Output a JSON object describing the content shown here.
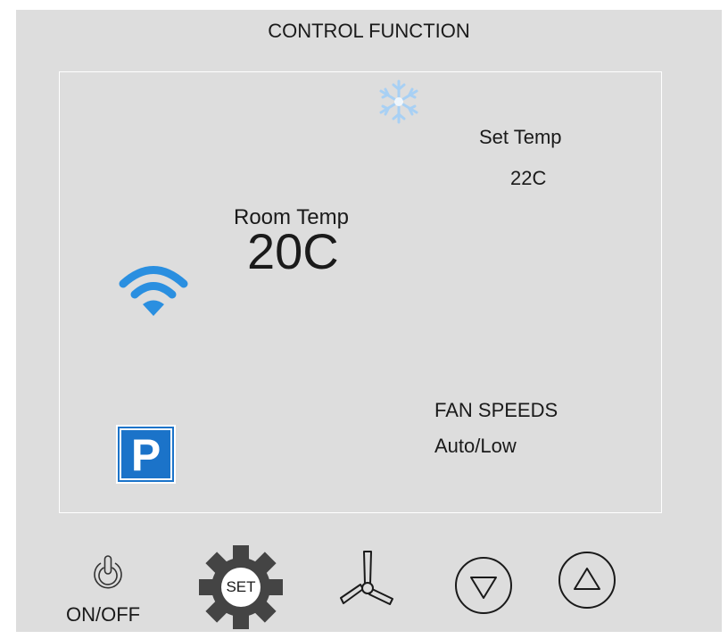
{
  "header": {
    "title": "CONTROL FUNCTION"
  },
  "display": {
    "mode_icon": "snowflake-icon",
    "set_temp_label": "Set Temp",
    "set_temp_value": "22C",
    "room_temp_label": "Room Temp",
    "room_temp_value": "20C",
    "wifi_icon": "wifi-icon",
    "fan_speeds_label": "FAN SPEEDS",
    "fan_speeds_value": "Auto/Low",
    "parking_icon": "parking-icon",
    "parking_letter": "P"
  },
  "controls": {
    "power_icon": "power-icon",
    "power_label": "ON/OFF",
    "set_label": "SET",
    "fan_icon": "fan-icon",
    "down_icon": "arrow-down-icon",
    "up_icon": "arrow-up-icon"
  },
  "colors": {
    "panel": "#dddddd",
    "wifi": "#2a8fe0",
    "snowflake": "#a8d0f4",
    "parking": "#1b73c9",
    "gear": "#444444"
  }
}
